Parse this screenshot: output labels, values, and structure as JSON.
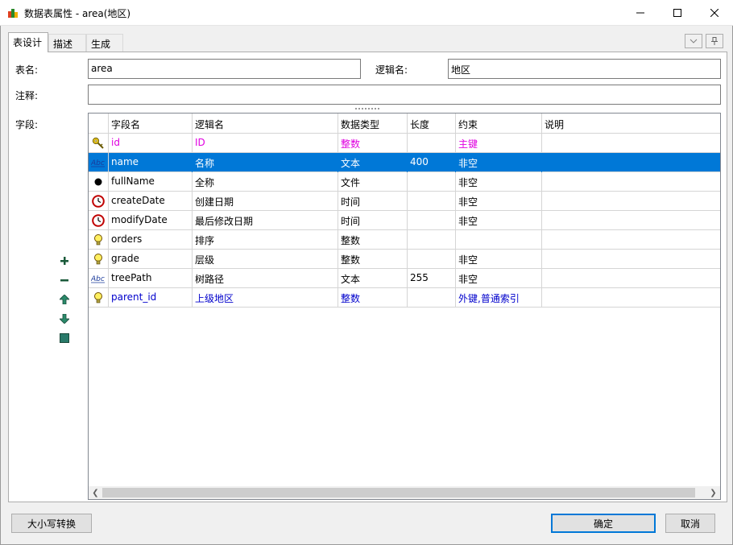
{
  "window": {
    "title": "数据表属性 - area(地区)"
  },
  "tabs": [
    "表设计",
    "描述",
    "生成"
  ],
  "form": {
    "table_name_label": "表名:",
    "table_name_value": "area",
    "logical_name_label": "逻辑名:",
    "logical_name_value": "地区",
    "comment_label": "注释:",
    "comment_value": "",
    "fields_label": "字段:"
  },
  "grid": {
    "columns": [
      "字段名",
      "逻辑名",
      "数据类型",
      "长度",
      "约束",
      "说明"
    ],
    "rows": [
      {
        "icon": "key-icon",
        "name": "id",
        "logical": "ID",
        "type": "整数",
        "length": "",
        "constraint": "主键",
        "desc": "",
        "color": "#e000e0"
      },
      {
        "icon": "text-abc-icon",
        "name": "name",
        "logical": "名称",
        "type": "文本",
        "length": "400",
        "constraint": "非空",
        "desc": "",
        "selected": true
      },
      {
        "icon": "black-dot-icon",
        "name": "fullName",
        "logical": "全称",
        "type": "文件",
        "length": "",
        "constraint": "非空",
        "desc": ""
      },
      {
        "icon": "clock-icon",
        "name": "createDate",
        "logical": "创建日期",
        "type": "时间",
        "length": "",
        "constraint": "非空",
        "desc": ""
      },
      {
        "icon": "clock-icon",
        "name": "modifyDate",
        "logical": "最后修改日期",
        "type": "时间",
        "length": "",
        "constraint": "非空",
        "desc": ""
      },
      {
        "icon": "bulb-icon",
        "name": "orders",
        "logical": "排序",
        "type": "整数",
        "length": "",
        "constraint": "",
        "desc": ""
      },
      {
        "icon": "bulb-icon",
        "name": "grade",
        "logical": "层级",
        "type": "整数",
        "length": "",
        "constraint": "非空",
        "desc": ""
      },
      {
        "icon": "text-abc-icon",
        "name": "treePath",
        "logical": "树路径",
        "type": "文本",
        "length": "255",
        "constraint": "非空",
        "desc": ""
      },
      {
        "icon": "bulb-icon",
        "name": "parent_id",
        "logical": "上级地区",
        "type": "整数",
        "length": "",
        "constraint": "外键,普通索引",
        "desc": "",
        "color": "#0000cc"
      }
    ]
  },
  "side_tools": [
    "add-icon",
    "remove-icon",
    "move-up-icon",
    "move-down-icon",
    "square-icon"
  ],
  "buttons": {
    "case_convert": "大小写转换",
    "ok": "确定",
    "cancel": "取消"
  },
  "colors": {
    "selection": "#0078d7",
    "pk": "#e000e0",
    "fk": "#0000cc"
  }
}
